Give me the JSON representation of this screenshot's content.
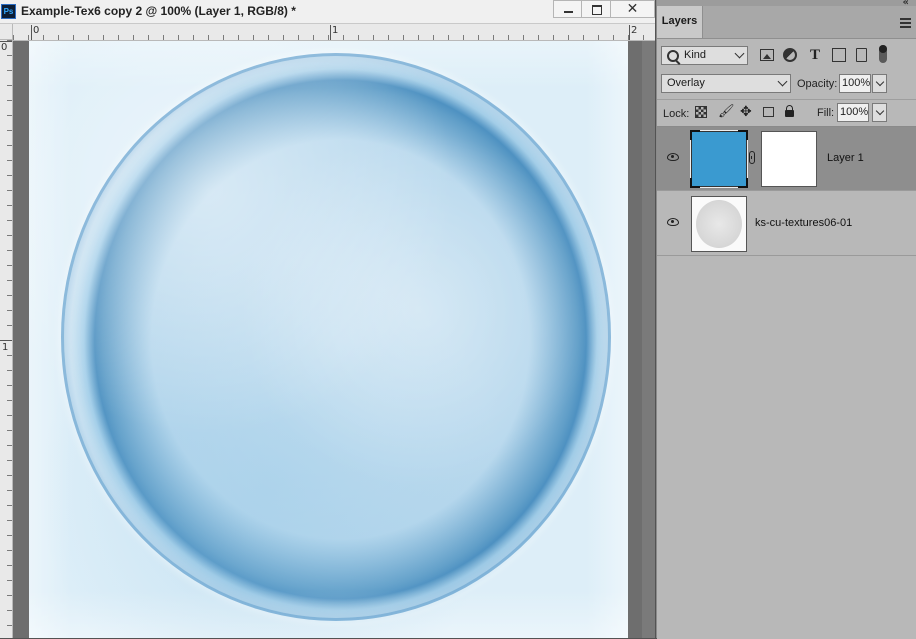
{
  "document": {
    "title": "Example-Tex6 copy 2 @ 100% (Layer 1, RGB/8) *",
    "app_badge": "Ps",
    "close_glyph": "✕",
    "ruler_top_labels": [
      "0",
      "1",
      "2"
    ],
    "ruler_left_labels": [
      "0",
      "1"
    ]
  },
  "layers_panel": {
    "tab_label": "Layers",
    "collapse_glyph": "«",
    "filter": {
      "kind_label": "Kind"
    },
    "blend_mode": "Overlay",
    "opacity_label": "Opacity:",
    "opacity_value": "100%",
    "lock_label": "Lock:",
    "fill_label": "Fill:",
    "fill_value": "100%",
    "type_icon_glyph": "T",
    "paint_icon_glyph": "🖌",
    "move_icon_glyph": "✥",
    "layers": [
      {
        "name": "Layer 1",
        "selected": true,
        "visible": true,
        "thumb_color": "#3a9ad0",
        "has_mask": true
      },
      {
        "name": "ks-cu-textures06-01",
        "selected": false,
        "visible": true
      }
    ]
  }
}
